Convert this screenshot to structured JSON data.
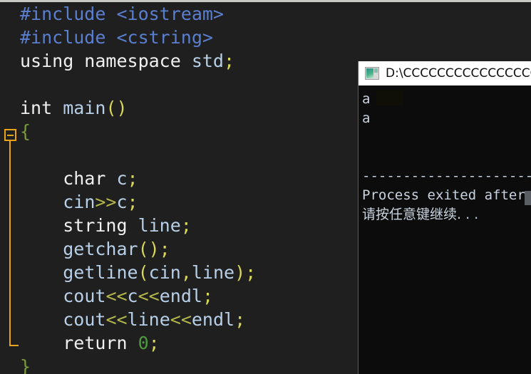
{
  "window": {
    "top_strip": "title-bar-strip"
  },
  "editor": {
    "name": "cpp-source-editor",
    "language": "C++",
    "background_color": "#1e1f1e",
    "fold_marker": "collapse-block",
    "lines": [
      {
        "indent": 0,
        "tokens": [
          {
            "t": "#include ",
            "c": "tok-pre"
          },
          {
            "t": "<iostream>",
            "c": "tok-pre"
          }
        ]
      },
      {
        "indent": 0,
        "tokens": [
          {
            "t": "#include ",
            "c": "tok-pre"
          },
          {
            "t": "<cstring>",
            "c": "tok-pre"
          }
        ]
      },
      {
        "indent": 0,
        "tokens": [
          {
            "t": "using namespace ",
            "c": "tok-plain"
          },
          {
            "t": "std",
            "c": "tok-type"
          },
          {
            "t": ";",
            "c": "tok-punct"
          }
        ]
      },
      {
        "indent": 0,
        "tokens": []
      },
      {
        "indent": 0,
        "tokens": [
          {
            "t": "int ",
            "c": "tok-plain"
          },
          {
            "t": "main",
            "c": "tok-type"
          },
          {
            "t": "()",
            "c": "tok-punct"
          }
        ]
      },
      {
        "indent": 0,
        "tokens": [
          {
            "t": "{",
            "c": "tok-brace"
          }
        ]
      },
      {
        "indent": 0,
        "tokens": []
      },
      {
        "indent": 1,
        "tokens": [
          {
            "t": "char ",
            "c": "tok-plain"
          },
          {
            "t": "c",
            "c": "tok-type"
          },
          {
            "t": ";",
            "c": "tok-punct"
          }
        ]
      },
      {
        "indent": 1,
        "tokens": [
          {
            "t": "cin",
            "c": "tok-type"
          },
          {
            "t": ">>",
            "c": "tok-op"
          },
          {
            "t": "c",
            "c": "tok-type"
          },
          {
            "t": ";",
            "c": "tok-punct"
          }
        ]
      },
      {
        "indent": 1,
        "tokens": [
          {
            "t": "string ",
            "c": "tok-plain"
          },
          {
            "t": "line",
            "c": "tok-type"
          },
          {
            "t": ";",
            "c": "tok-punct"
          }
        ]
      },
      {
        "indent": 1,
        "tokens": [
          {
            "t": "getchar",
            "c": "tok-type"
          },
          {
            "t": "();",
            "c": "tok-punct"
          }
        ]
      },
      {
        "indent": 1,
        "tokens": [
          {
            "t": "getline",
            "c": "tok-type"
          },
          {
            "t": "(",
            "c": "tok-punct"
          },
          {
            "t": "cin",
            "c": "tok-type"
          },
          {
            "t": ",",
            "c": "tok-punct"
          },
          {
            "t": "line",
            "c": "tok-type"
          },
          {
            "t": ");",
            "c": "tok-punct"
          }
        ]
      },
      {
        "indent": 1,
        "tokens": [
          {
            "t": "cout",
            "c": "tok-type"
          },
          {
            "t": "<<",
            "c": "tok-op"
          },
          {
            "t": "c",
            "c": "tok-type"
          },
          {
            "t": "<<",
            "c": "tok-op"
          },
          {
            "t": "endl",
            "c": "tok-type"
          },
          {
            "t": ";",
            "c": "tok-punct"
          }
        ]
      },
      {
        "indent": 1,
        "tokens": [
          {
            "t": "cout",
            "c": "tok-type"
          },
          {
            "t": "<<",
            "c": "tok-op"
          },
          {
            "t": "line",
            "c": "tok-type"
          },
          {
            "t": "<<",
            "c": "tok-op"
          },
          {
            "t": "endl",
            "c": "tok-type"
          },
          {
            "t": ";",
            "c": "tok-punct"
          }
        ]
      },
      {
        "indent": 1,
        "tokens": [
          {
            "t": "return ",
            "c": "tok-plain"
          },
          {
            "t": "0",
            "c": "tok-num"
          },
          {
            "t": ";",
            "c": "tok-punct"
          }
        ]
      },
      {
        "indent": 0,
        "tokens": [
          {
            "t": "}",
            "c": "tok-brace"
          }
        ]
      }
    ]
  },
  "console": {
    "name": "program-output-console",
    "icon": "console-window-icon",
    "title": "D:\\CCCCCCCCCCCCCCCCC",
    "background_color": "#0c0c0c",
    "text_color": "#c9d3e0",
    "output_lines": [
      "a",
      "a",
      "",
      "",
      "--------------------------------",
      "Process exited after",
      "请按任意键继续. . ."
    ],
    "cursor": "text-cursor-block"
  }
}
